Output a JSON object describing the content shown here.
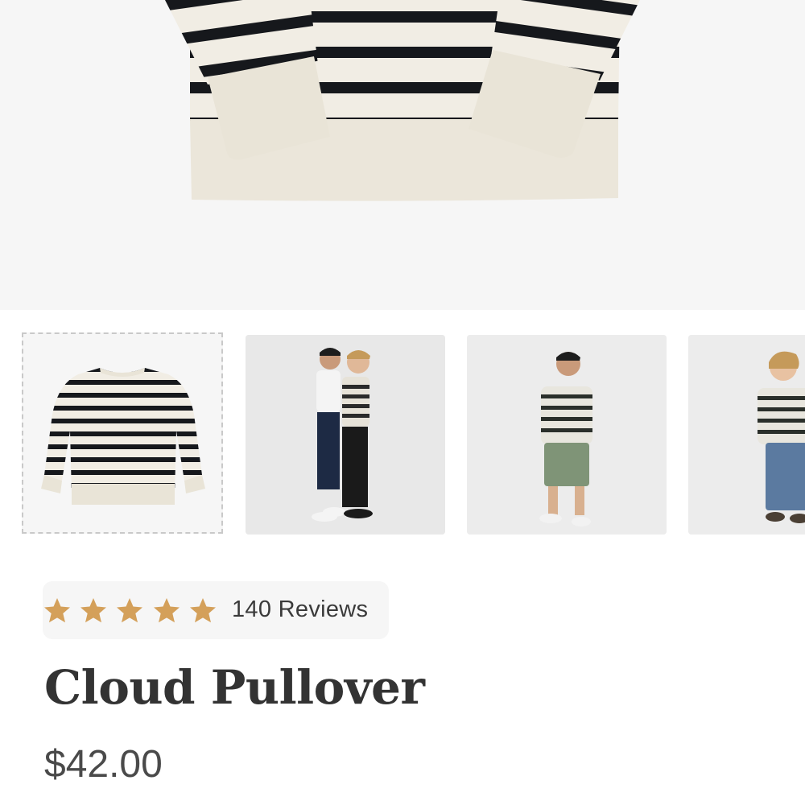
{
  "product": {
    "title": "Cloud Pullover",
    "price": "$42.00"
  },
  "reviews": {
    "rating": 5,
    "max_rating": 5,
    "label": "140 Reviews",
    "star_color": "#d4a05a"
  },
  "gallery": {
    "main_image": "striped-pullover-close-up",
    "thumbnails": [
      {
        "image": "striped-pullover-flat-lay",
        "selected": true
      },
      {
        "image": "two-kids-back-to-back",
        "selected": false
      },
      {
        "image": "kid-in-striped-pullover-and-green-shorts",
        "selected": false
      },
      {
        "image": "kid-in-striped-pullover-and-jeans",
        "selected": false
      }
    ]
  },
  "colors": {
    "accent": "#d4a05a",
    "text": "#333333",
    "background": "#ffffff",
    "image_background": "#f6f6f6"
  }
}
